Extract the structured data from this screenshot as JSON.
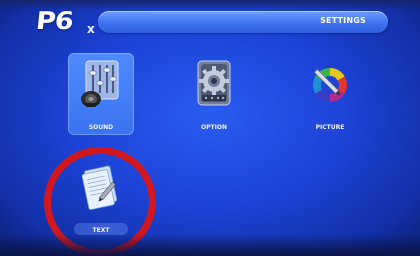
{
  "header": {
    "logo": "P6",
    "logo_sub": "x",
    "title": "SETTINGS"
  },
  "menu": {
    "items": [
      {
        "id": "sound",
        "label": "SOUND",
        "icon": "speaker-equalizer-icon",
        "selected": true
      },
      {
        "id": "option",
        "label": "OPTION",
        "icon": "gear-film-icon",
        "selected": false
      },
      {
        "id": "picture",
        "label": "PICTURE",
        "icon": "color-wheel-pen-icon",
        "selected": false
      },
      {
        "id": "text",
        "label": "TEXT",
        "icon": "document-pen-icon",
        "selected": false
      }
    ]
  },
  "colors": {
    "background": "#1d43d8",
    "title_bar": "#3e72f2",
    "selected_tile": "#3a73f2",
    "annotation_circle": "#d2181e"
  }
}
